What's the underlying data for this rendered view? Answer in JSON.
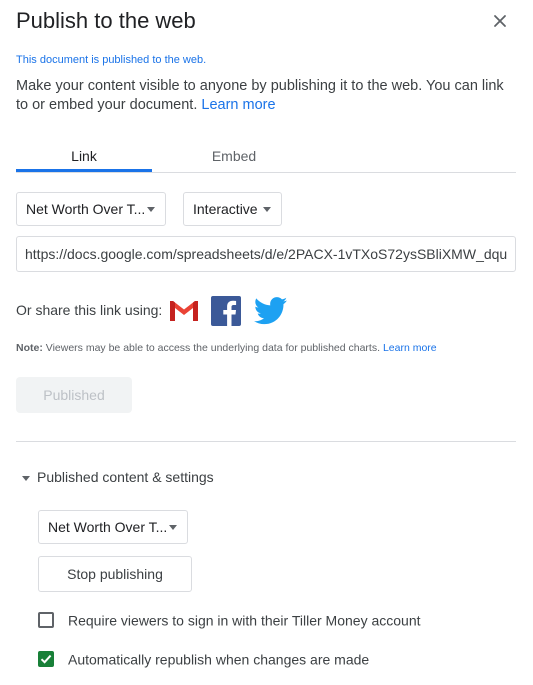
{
  "dialog": {
    "title": "Publish to the web",
    "status": "This document is published to the web.",
    "description": "Make your content visible to anyone by publishing it to the web. You can link to or embed your document.",
    "learn_more": "Learn more"
  },
  "tabs": [
    {
      "label": "Link",
      "active": true
    },
    {
      "label": "Embed",
      "active": false
    }
  ],
  "link": {
    "sheet_select": "Net Worth Over T...",
    "format_select": "Interactive",
    "url": "https://docs.google.com/spreadsheets/d/e/2PACX-1vTXoS72ysSBliXMW_dqu",
    "share_label": "Or share this link using:",
    "share_icons": [
      "gmail-icon",
      "facebook-icon",
      "twitter-icon"
    ],
    "note_prefix": "Note:",
    "note_text": "Viewers may be able to access the underlying data for published charts.",
    "note_link": "Learn more",
    "published_button": "Published"
  },
  "settings": {
    "section_label": "Published content & settings",
    "sheet_select": "Net Worth Over T...",
    "stop_button": "Stop publishing",
    "checkboxes": [
      {
        "label": "Require viewers to sign in with their Tiller Money account",
        "checked": false
      },
      {
        "label": "Automatically republish when changes are made",
        "checked": true
      }
    ]
  },
  "colors": {
    "accent": "#1a73e8",
    "checkbox_checked": "#188038",
    "gmail_red": "#EA4335",
    "facebook_blue": "#3B5998",
    "twitter_blue": "#1DA1F2"
  }
}
